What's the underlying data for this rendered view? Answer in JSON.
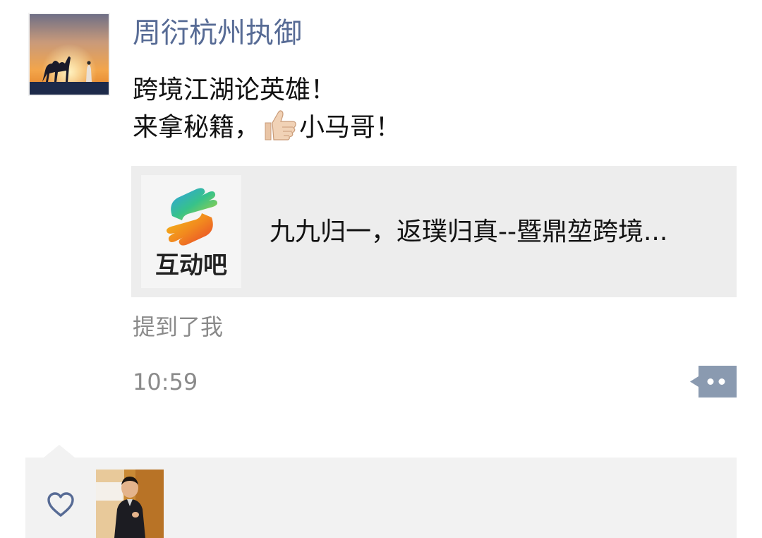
{
  "post": {
    "author_name": "周衍杭州执御",
    "content_lines": [
      "跨境江湖论英雄！",
      "来拿秘籍，",
      "小马哥！"
    ],
    "emoji": "thumbs-up-icon",
    "share_card": {
      "logo_text": "互动吧",
      "title": "九九归一，返璞归真--暨鼎堃跨境..."
    },
    "mention": "提到了我",
    "time": "10:59"
  },
  "likes": {
    "icon": "heart-icon"
  },
  "colors": {
    "name_link": "#576b95",
    "secondary_text": "#8a8a8a",
    "card_bg": "#ededed",
    "panel_bg": "#f2f2f2"
  }
}
